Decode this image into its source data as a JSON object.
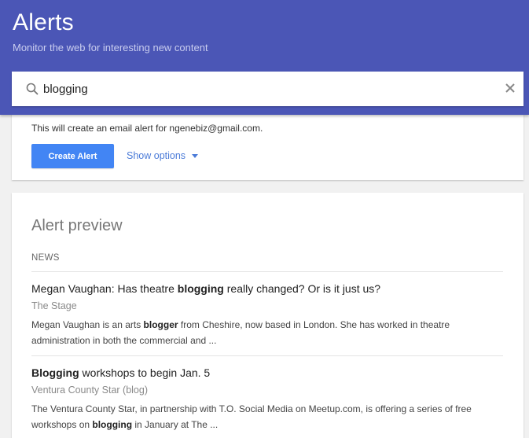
{
  "header": {
    "title": "Alerts",
    "subtitle": "Monitor the web for interesting new content"
  },
  "search": {
    "value": "blogging"
  },
  "create_card": {
    "email_note": "This will create an email alert for ngenebiz@gmail.com.",
    "create_button": "Create Alert",
    "show_options": "Show options"
  },
  "preview": {
    "title": "Alert preview",
    "section": "NEWS",
    "results": [
      {
        "title_pre": "Megan Vaughan: Has theatre ",
        "title_bold": "blogging",
        "title_post": " really changed? Or is it just us?",
        "source": "The Stage",
        "snippet_pre": "Megan Vaughan is an arts ",
        "snippet_bold": "blogger",
        "snippet_post": " from Cheshire, now based in London. She has worked in theatre administration in both the commercial and ..."
      },
      {
        "title_bold": "Blogging",
        "title_post": " workshops to begin Jan. 5",
        "source": "Ventura County Star (blog)",
        "snippet_pre": "The Ventura County Star, in partnership with T.O. Social Media on Meetup.com, is offering a series of free workshops on ",
        "snippet_bold": "blogging",
        "snippet_post": " in January at The ..."
      }
    ]
  },
  "colors": {
    "header_bg": "#4b56b6",
    "button_bg": "#4285f4",
    "link": "#4b7bd8"
  }
}
